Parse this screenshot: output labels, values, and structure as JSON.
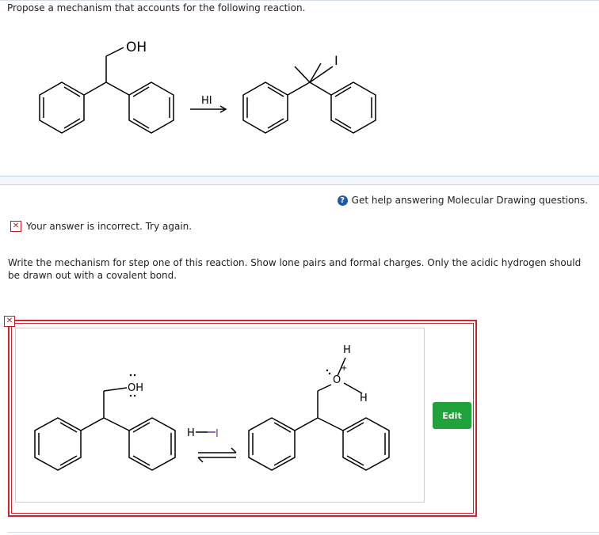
{
  "question": {
    "prompt": "Propose a mechanism that accounts for the following reaction."
  },
  "reaction": {
    "reactant_oh_label": "OH",
    "reagent_label": "HI",
    "product_i_label": "I"
  },
  "help": {
    "label": "Get help answering Molecular Drawing questions.",
    "icon": "question-circle-icon"
  },
  "feedback": {
    "message": "Your answer is incorrect.  Try again.",
    "icon": "x-mark-icon",
    "color": "#c41c1c"
  },
  "instructions": "Write the mechanism for step one of this reaction. Show lone pairs and formal charges. Only the acidic hydrogen should be drawn out with a covalent bond.",
  "answer": {
    "left_oh_label": "OH",
    "hi_h_label": "H",
    "hi_i_label": "I",
    "oxonium_o_label": "O",
    "oxonium_top_h_label": "H",
    "oxonium_right_h_label": "H",
    "charge_label": "+",
    "edit_button_label": "Edit",
    "frame_color": "#d2232a",
    "edit_color": "#21a23a",
    "arrow_color": "#7b2fbf"
  }
}
